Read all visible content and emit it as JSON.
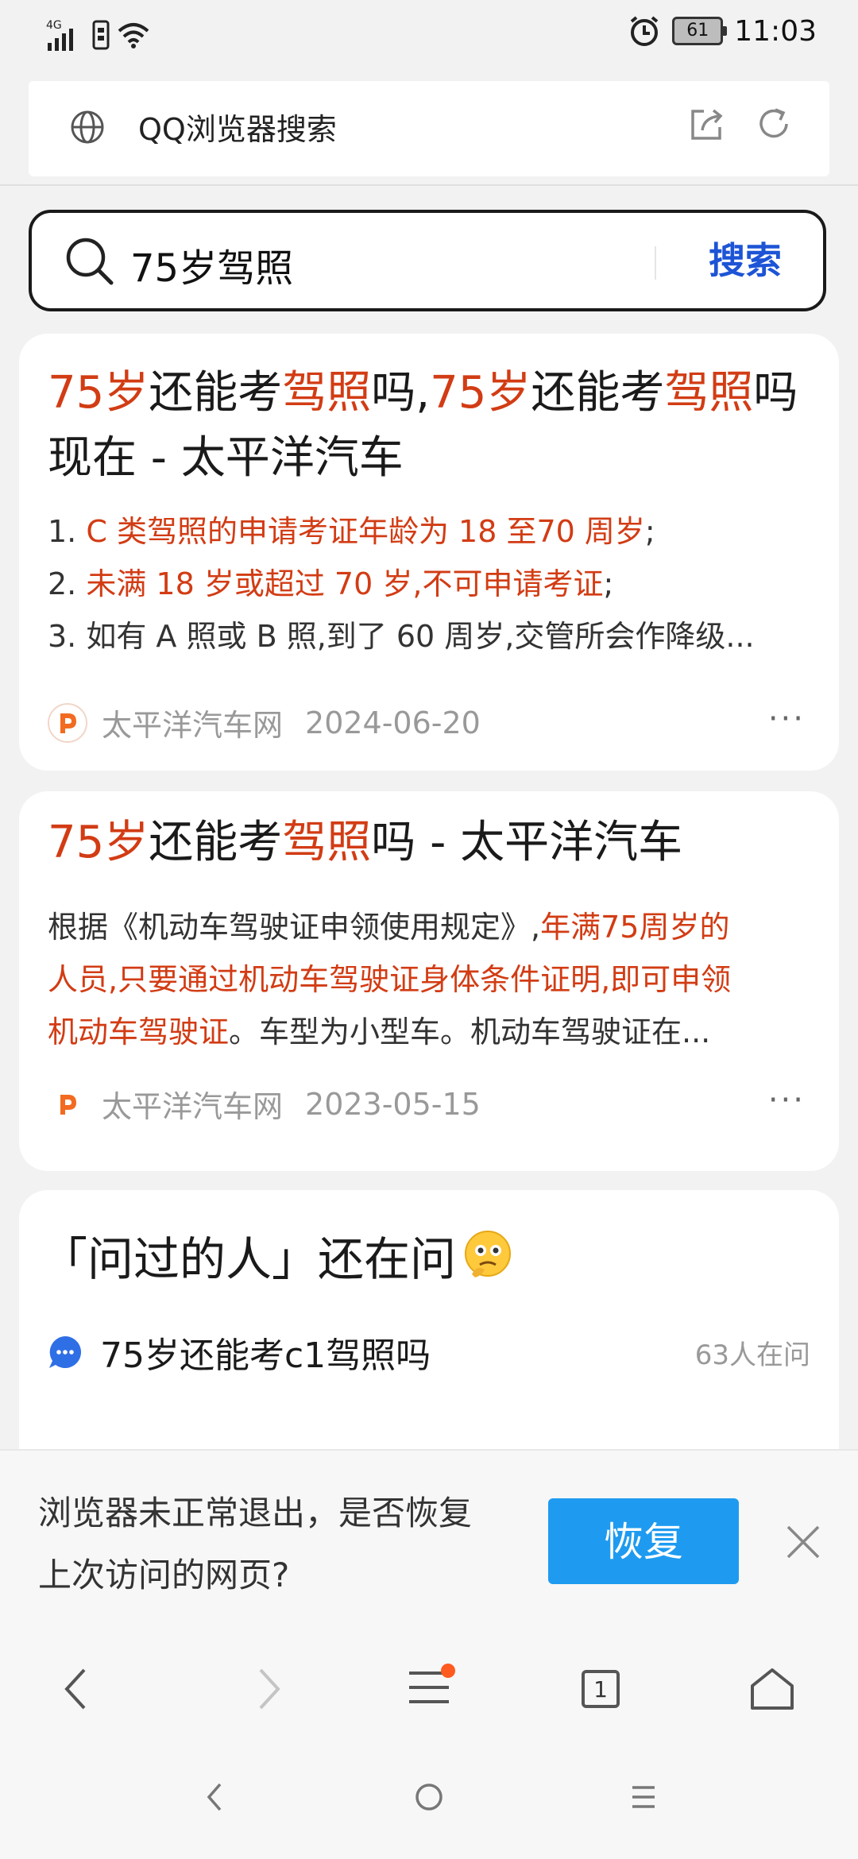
{
  "status_bar": {
    "network": "4G",
    "battery": "61",
    "time": "11:03"
  },
  "address_bar": {
    "title": "QQ浏览器搜索"
  },
  "search": {
    "query": "75岁驾照",
    "button_label": "搜索"
  },
  "results": [
    {
      "title_parts": [
        {
          "t": "75岁",
          "hl": true
        },
        {
          "t": "还能考",
          "hl": false
        },
        {
          "t": "驾照",
          "hl": true
        },
        {
          "t": "吗,",
          "hl": false
        },
        {
          "t": "75岁",
          "hl": true
        },
        {
          "t": "还能考",
          "hl": false
        },
        {
          "t": "驾照",
          "hl": true
        },
        {
          "t": "吗现在 - 太平洋汽车",
          "hl": false
        }
      ],
      "snippet_lines": [
        [
          {
            "t": "1. ",
            "hl": false
          },
          {
            "t": "C 类驾照的申请考证年龄为 18 至70 周岁",
            "hl": true
          },
          {
            "t": ";",
            "hl": false
          }
        ],
        [
          {
            "t": "2. ",
            "hl": false
          },
          {
            "t": "未满 18 岁或超过 70 岁,不可申请考证",
            "hl": true
          },
          {
            "t": ";",
            "hl": false
          }
        ],
        [
          {
            "t": "3. 如有 A 照或 B 照,到了 60 周岁,交管所会作降级...",
            "hl": false
          }
        ]
      ],
      "site": "太平洋汽车网",
      "date": "2024-06-20",
      "more": "···"
    },
    {
      "title_parts": [
        {
          "t": "75岁",
          "hl": true
        },
        {
          "t": "还能考",
          "hl": false
        },
        {
          "t": "驾照",
          "hl": true
        },
        {
          "t": "吗 - 太平洋汽车",
          "hl": false
        }
      ],
      "snippet_lines": [
        [
          {
            "t": "根据《机动车驾驶证申领使用规定》,",
            "hl": false
          },
          {
            "t": "年满75周岁的",
            "hl": true
          }
        ],
        [
          {
            "t": "人员,只要通过机动车驾驶证身体条件证明,即可申领",
            "hl": true
          }
        ],
        [
          {
            "t": "机动车驾驶证",
            "hl": true
          },
          {
            "t": "。车型为小型车。机动车驾驶证在...",
            "hl": false
          }
        ]
      ],
      "site": "太平洋汽车网",
      "date": "2023-05-15",
      "more": "···"
    }
  ],
  "asked": {
    "heading": "「问过的人」还在问",
    "question": "75岁还能考c1驾照吗",
    "count": "63人在问"
  },
  "restore": {
    "message": "浏览器未正常退出，是否恢复上次访问的网页?",
    "button": "恢复"
  },
  "toolbar": {
    "tab_count": "1"
  },
  "colors": {
    "highlight": "#d23c14",
    "search_button": "#1d54d6",
    "restore_button": "#1e9bf0",
    "badge": "#ff5a1f"
  }
}
